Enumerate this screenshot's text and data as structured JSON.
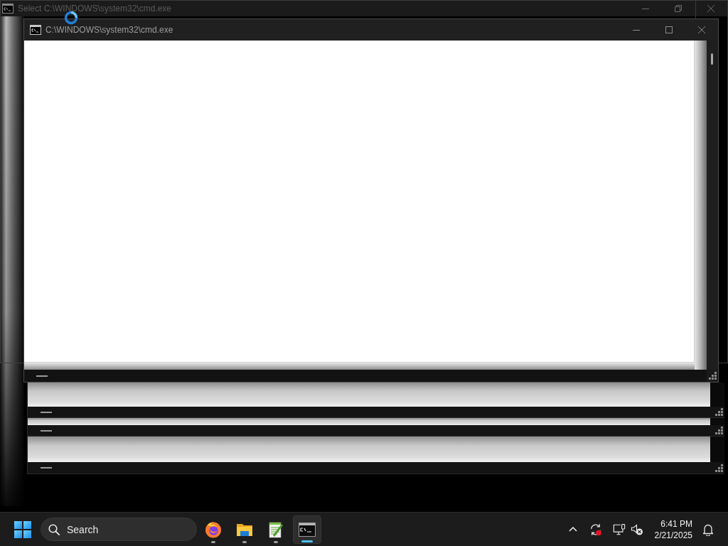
{
  "background_window": {
    "title": "Select C:\\WINDOWS\\system32\\cmd.exe"
  },
  "main_window": {
    "title": "C:\\WINDOWS\\system32\\cmd.exe"
  },
  "taskbar": {
    "search": {
      "placeholder": "Search"
    },
    "apps": [
      {
        "kind": "browser",
        "selected": false
      },
      {
        "kind": "folder",
        "selected": false
      },
      {
        "kind": "notepad",
        "selected": false
      },
      {
        "kind": "terminal",
        "selected": true
      }
    ],
    "clock": {
      "time": "6:41 PM",
      "date": "2/21/2025"
    }
  }
}
